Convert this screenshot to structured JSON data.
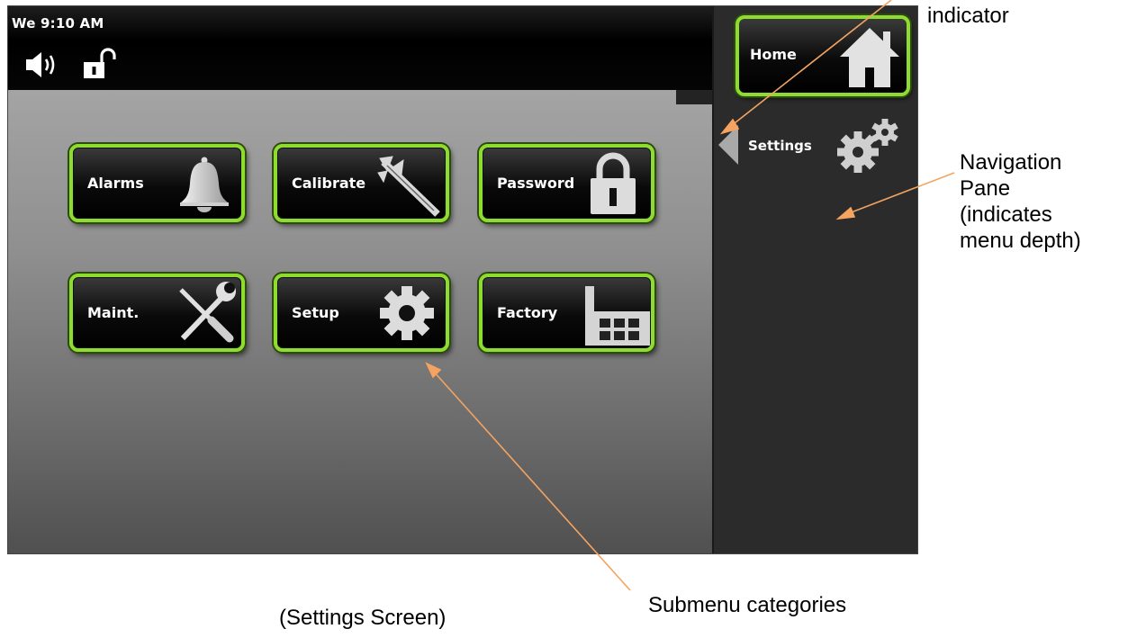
{
  "status_bar": {
    "time": "We 9:10 AM",
    "icons": [
      "speaker-icon",
      "unlocked-padlock-icon"
    ]
  },
  "main": {
    "buttons": [
      {
        "label": "Alarms",
        "icon": "bell-icon"
      },
      {
        "label": "Calibrate",
        "icon": "caliper-icon"
      },
      {
        "label": "Password",
        "icon": "padlock-icon"
      },
      {
        "label": "Maint.",
        "icon": "wrench-screwdriver-icon"
      },
      {
        "label": "Setup",
        "icon": "gear-icon"
      },
      {
        "label": "Factory",
        "icon": "factory-icon"
      }
    ]
  },
  "nav": {
    "home_label": "Home",
    "home_icon": "house-icon",
    "current_label": "Settings",
    "current_icon": "gears-icon"
  },
  "annotations": {
    "indicator": "indicator",
    "navigation_pane": [
      "Navigation",
      "Pane",
      "(indicates",
      "menu depth)"
    ],
    "submenu": "Submenu categories",
    "caption": "(Settings Screen)"
  },
  "colors": {
    "button_border": "#8ddc2f",
    "nav_pane": "#2b2b2b",
    "annotation_arrow": "#f4a460"
  }
}
